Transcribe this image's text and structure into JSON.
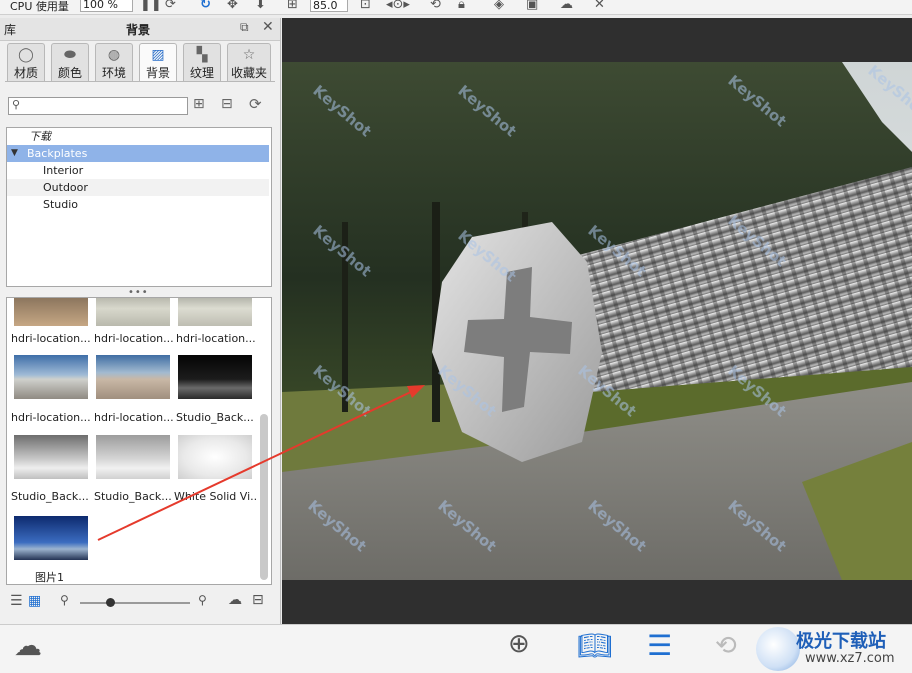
{
  "toolbar": {
    "cpu_label": "CPU 使用量",
    "cpu_value": "100 %",
    "zoom_value": "85.0"
  },
  "panel": {
    "title_left": "库",
    "title_center": "背景",
    "tabs": [
      {
        "label": "材质",
        "icon": "material-icon"
      },
      {
        "label": "颜色",
        "icon": "color-icon"
      },
      {
        "label": "环境",
        "icon": "environment-icon"
      },
      {
        "label": "背景",
        "icon": "background-icon"
      },
      {
        "label": "纹理",
        "icon": "texture-icon"
      },
      {
        "label": "收藏夹",
        "icon": "favorites-icon"
      }
    ],
    "search_placeholder": "",
    "tree": {
      "download": "下载",
      "backplates": "Backplates",
      "children": [
        "Interior",
        "Outdoor",
        "Studio"
      ]
    },
    "thumbnails": [
      {
        "label": "hdri-location..."
      },
      {
        "label": "hdri-location..."
      },
      {
        "label": "hdri-location..."
      },
      {
        "label": "hdri-location..."
      },
      {
        "label": "hdri-location..."
      },
      {
        "label": "Studio_Back..."
      },
      {
        "label": "Studio_Back..."
      },
      {
        "label": "Studio_Back..."
      },
      {
        "label": "White Solid Vi..."
      },
      {
        "label": "图片1"
      }
    ]
  },
  "viewport": {
    "watermark": "KeyShot"
  },
  "brand": {
    "name": "极光下载站",
    "url": "www.xz7.com"
  },
  "colors": {
    "accent": "#1f6fd1",
    "tree_selected": "#8fb3e8",
    "arrow": "#e53a2c"
  }
}
